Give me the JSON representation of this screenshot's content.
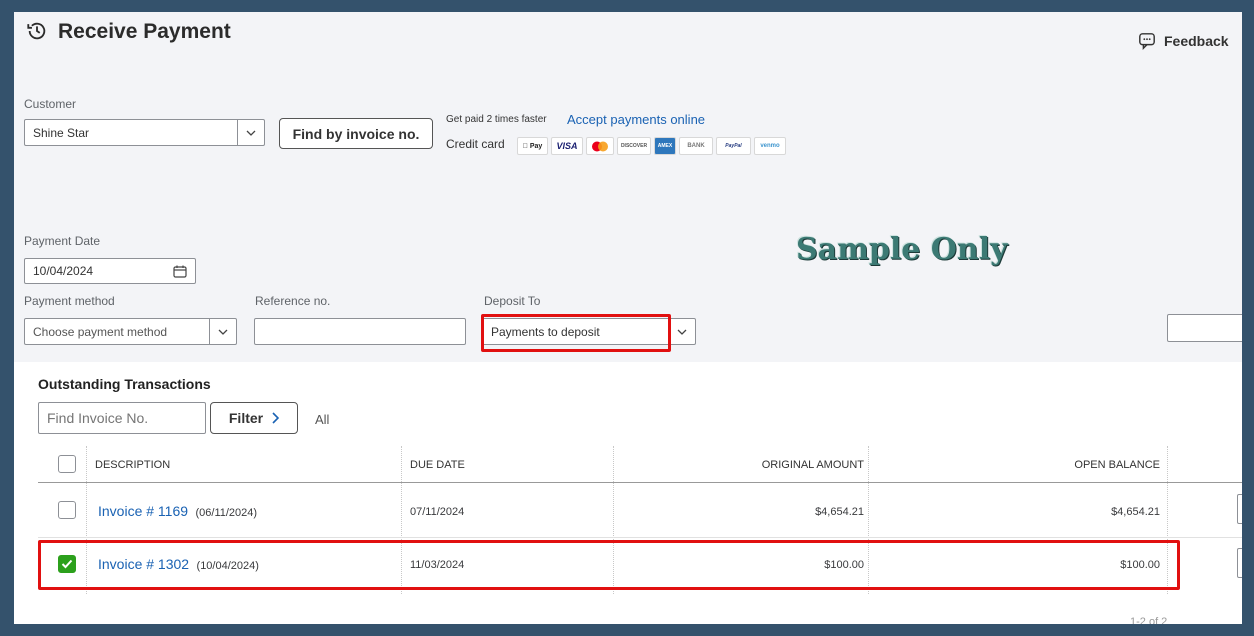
{
  "header": {
    "title": "Receive Payment",
    "feedback_label": "Feedback"
  },
  "customer": {
    "label": "Customer",
    "value": "Shine Star",
    "find_button": "Find by invoice no."
  },
  "promo": {
    "text": "Get paid 2 times faster",
    "link": "Accept payments online",
    "credit_card_label": "Credit card",
    "logos": [
      " Pay",
      "VISA",
      "DISCOVER",
      "AMEX",
      "BANK",
      "PayPal",
      "venmo"
    ]
  },
  "watermark": "Sample Only",
  "payment_date": {
    "label": "Payment Date",
    "value": "10/04/2024"
  },
  "payment_method": {
    "label": "Payment method",
    "placeholder": "Choose payment method"
  },
  "reference": {
    "label": "Reference no.",
    "value": ""
  },
  "deposit_to": {
    "label": "Deposit To",
    "value": "Payments to deposit"
  },
  "outstanding": {
    "title": "Outstanding Transactions",
    "find_placeholder": "Find Invoice No.",
    "filter_label": "Filter",
    "all_label": "All",
    "columns": [
      "DESCRIPTION",
      "DUE DATE",
      "ORIGINAL AMOUNT",
      "OPEN BALANCE"
    ],
    "rows": [
      {
        "invoice": "Invoice # 1169",
        "inv_date": "(06/11/2024)",
        "due": "07/11/2024",
        "original": "$4,654.21",
        "balance": "$4,654.21",
        "checked": false
      },
      {
        "invoice": "Invoice # 1302",
        "inv_date": "(10/04/2024)",
        "due": "11/03/2024",
        "original": "$100.00",
        "balance": "$100.00",
        "checked": true
      }
    ],
    "pagination": "1-2 of 2"
  },
  "colors": {
    "accent_green": "#2ca01c",
    "link_blue": "#1a62b3",
    "highlight_red": "#e11010",
    "frame": "#34526c"
  }
}
